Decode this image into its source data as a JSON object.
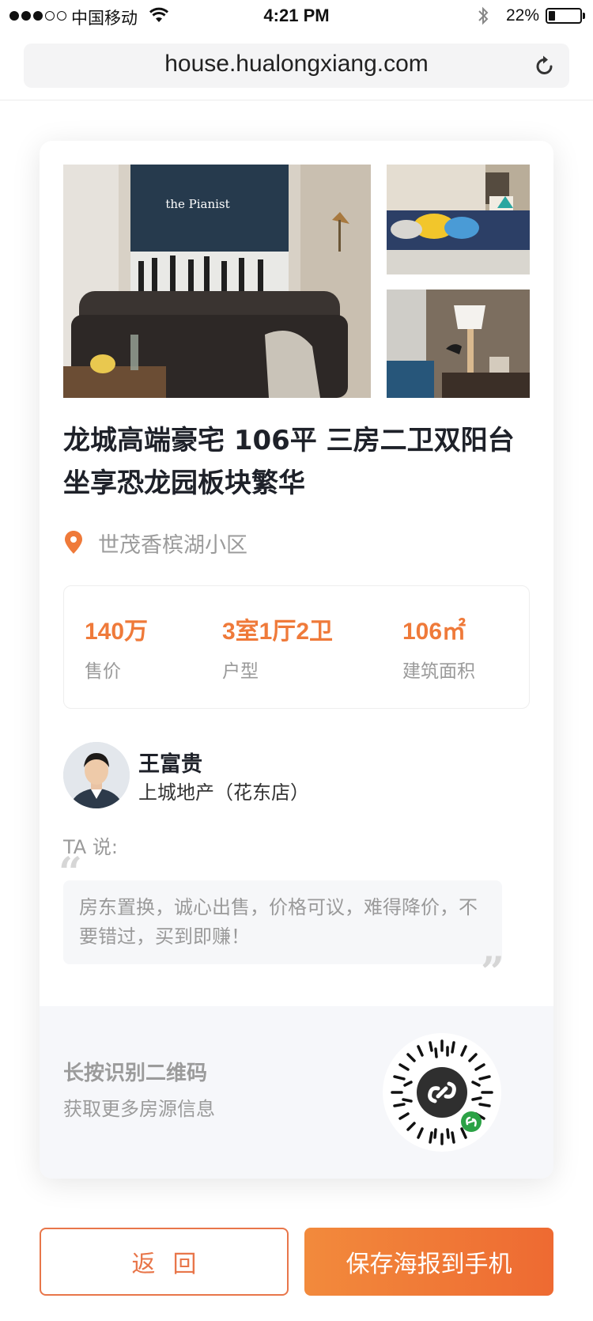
{
  "status_bar": {
    "carrier": "中国移动",
    "time": "4:21 PM",
    "battery": "22%",
    "battery_level": 0.22
  },
  "browser": {
    "url": "house.hualongxiang.com"
  },
  "listing": {
    "title_line1": "龙城高端豪宅 106平 三房二卫双阳台",
    "title_line2": "坐享恐龙园板块繁华",
    "location": "世茂香槟湖小区",
    "photo_poster_text": "the Pianist",
    "stats": [
      {
        "value": "140万",
        "label": "售价"
      },
      {
        "value": "3室1厅2卫",
        "label": "户型"
      },
      {
        "value": "106㎡",
        "label": "建筑面积"
      }
    ]
  },
  "agent": {
    "name": "王富贵",
    "company": "上城地产（花东店）"
  },
  "comment": {
    "label": "TA 说:",
    "text": "房东置换，诚心出售，价格可议，难得降价，不要错过，买到即赚！"
  },
  "qr": {
    "title": "长按识别二维码",
    "subtitle": "获取更多房源信息"
  },
  "buttons": {
    "back": "返回",
    "save": "保存海报到手机"
  },
  "colors": {
    "accent": "#ef7a3a",
    "button_gradient_start": "#f28a3c",
    "button_gradient_end": "#ee6a32",
    "muted_text": "#9a9a9a"
  },
  "icons": {
    "location": "map-pin-icon",
    "reload": "reload-icon",
    "wifi": "wifi-icon",
    "bluetooth": "bluetooth-icon",
    "mini_program": "mini-program-icon"
  }
}
